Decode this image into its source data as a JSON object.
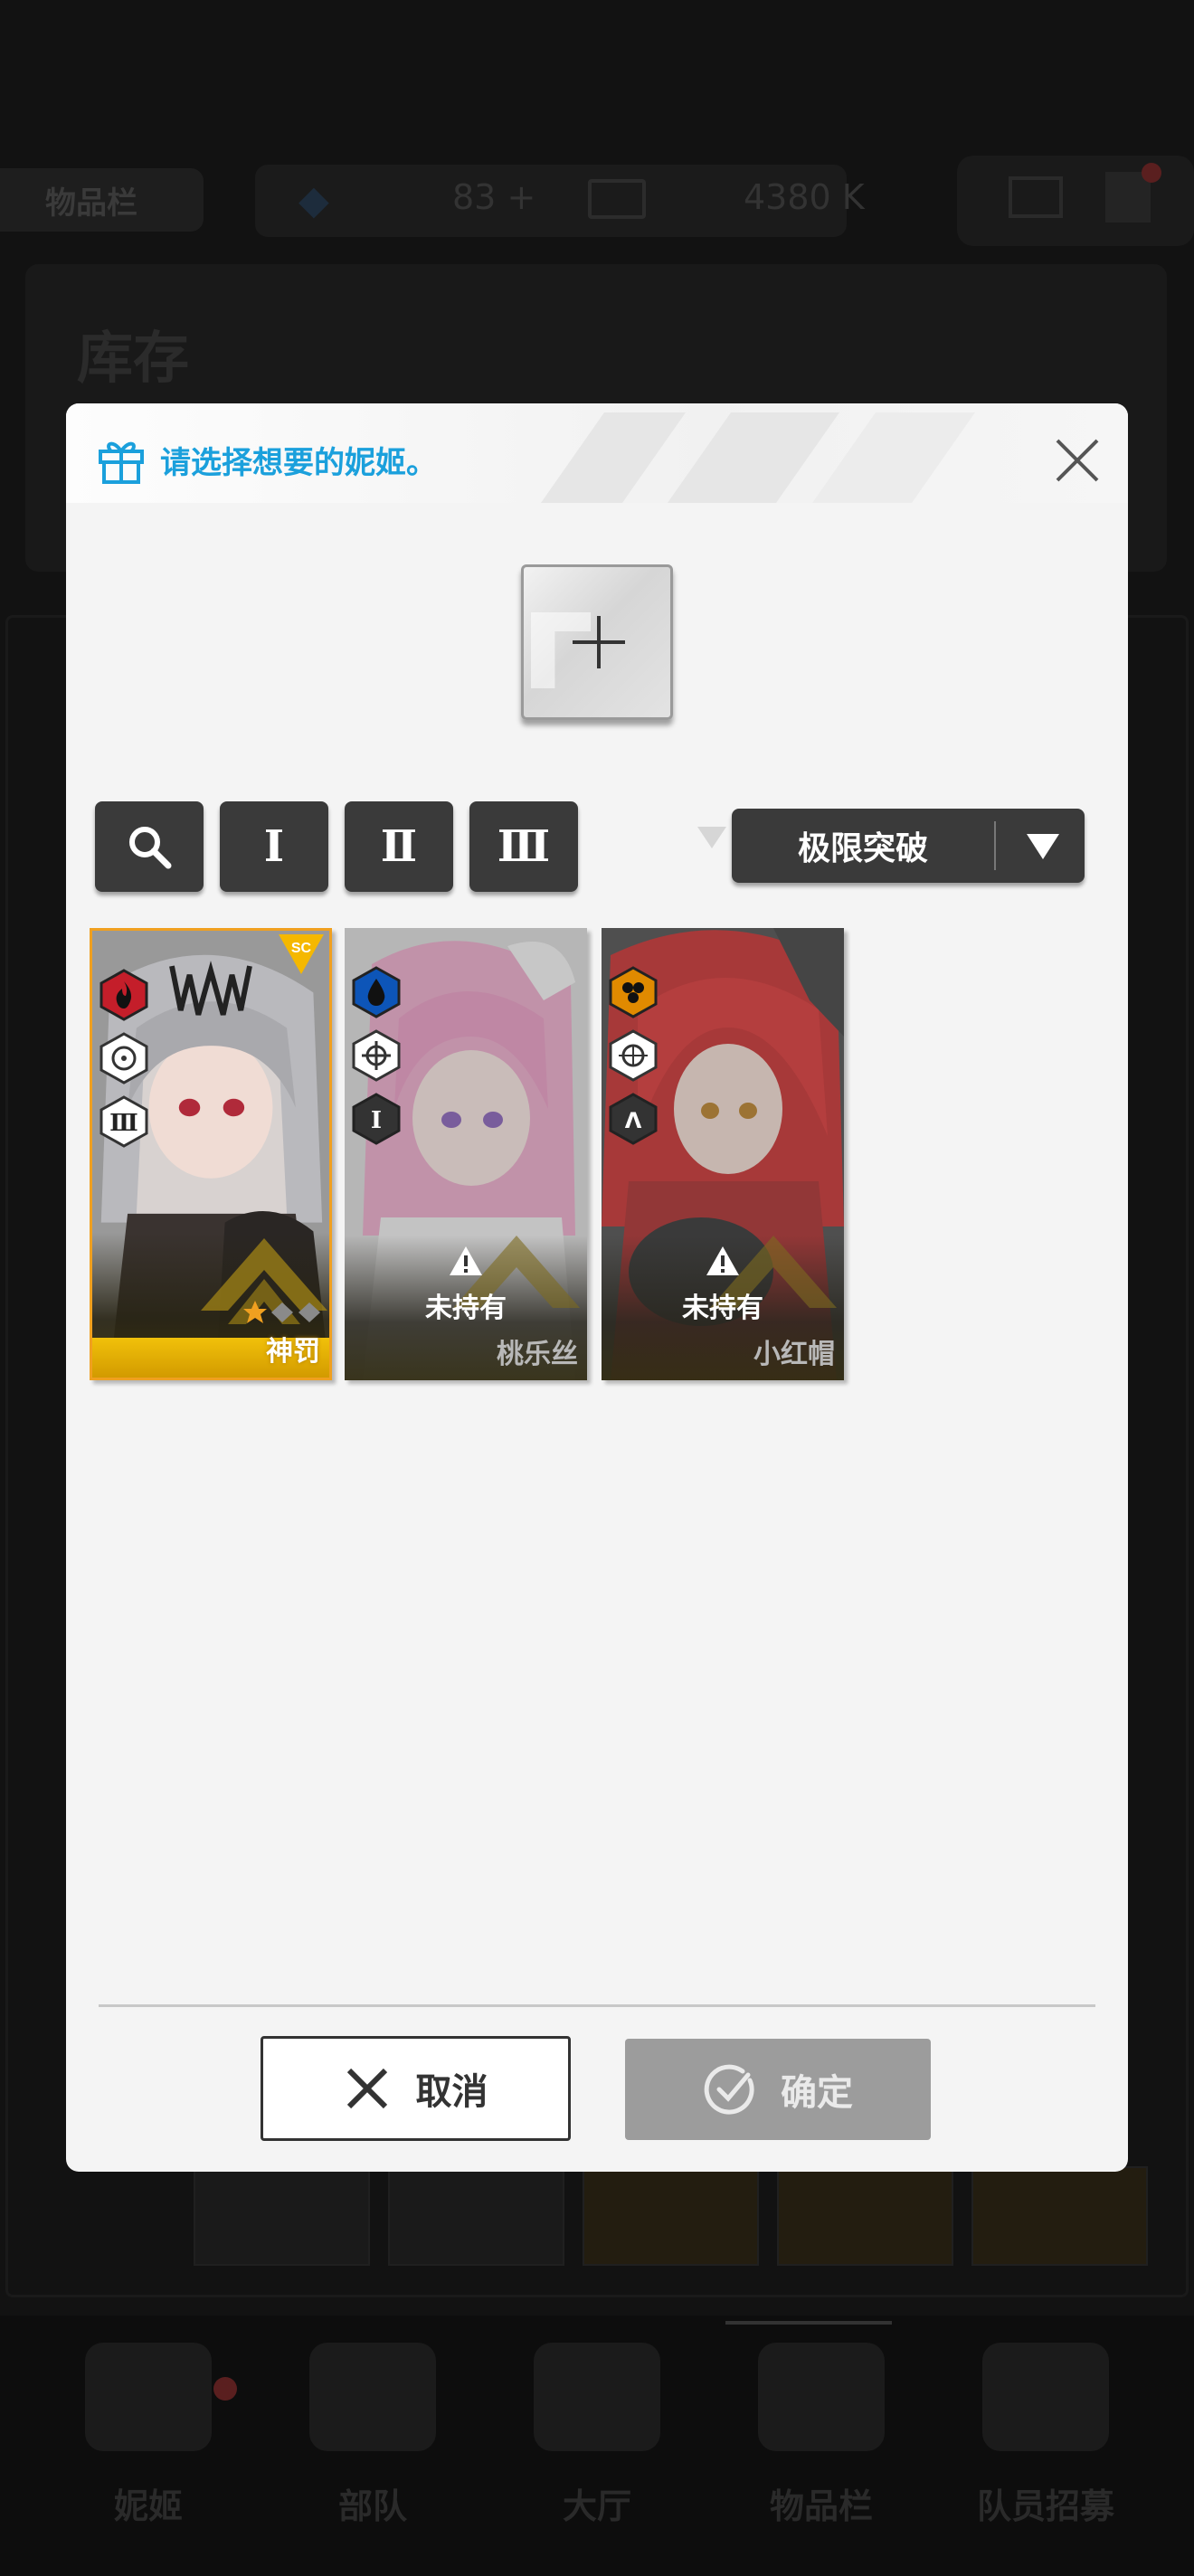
{
  "background": {
    "tab_label": "物品栏",
    "currency_1": "83",
    "currency_1_plus": "+",
    "currency_2": "4380 K",
    "panel_title": "库存",
    "nav_items": [
      {
        "label": "妮姬",
        "icon": "nikke-icon"
      },
      {
        "label": "部队",
        "icon": "squad-icon"
      },
      {
        "label": "大厅",
        "icon": "lobby-icon"
      },
      {
        "label": "物品栏",
        "icon": "inventory-icon"
      },
      {
        "label": "队员招募",
        "icon": "recruit-icon"
      }
    ]
  },
  "modal": {
    "title": "请选择想要的妮姬。",
    "filters": {
      "search_icon": "search-icon",
      "burst_1": "Ⅰ",
      "burst_2": "Ⅱ",
      "burst_3": "Ⅲ"
    },
    "sort": {
      "label": "极限突破",
      "caret_icon": "caret-down-icon"
    },
    "cards": [
      {
        "name": "神罚",
        "owned": true,
        "element_color": "#c41e2a",
        "element_icon": "fire-icon",
        "weapon_icon": "target-icon",
        "burst": "Ⅲ",
        "limit_break_stars": 1,
        "max_stars": 3,
        "accent_color": "#f5b800"
      },
      {
        "name": "桃乐丝",
        "owned": false,
        "status_label": "未持有",
        "element_color": "#0d55b8",
        "element_icon": "water-icon",
        "weapon_icon": "crosshair-icon",
        "burst": "Ⅰ"
      },
      {
        "name": "小红帽",
        "owned": false,
        "status_label": "未持有",
        "element_color": "#e08a00",
        "element_icon": "honeycomb-icon",
        "weapon_icon": "scope-icon",
        "burst": "Λ"
      }
    ],
    "cancel_label": "取消",
    "confirm_label": "确定"
  },
  "colors": {
    "title_blue": "#1ba0dc",
    "dark_button": "#3a3a3a",
    "disabled_button": "#9c9c9c"
  }
}
